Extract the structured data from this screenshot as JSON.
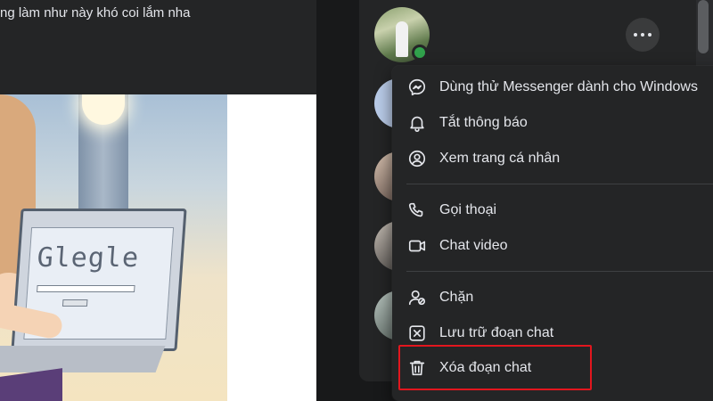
{
  "post": {
    "text": "ng làm như này khó coi lắm nha",
    "image_logo_text": "Glegle"
  },
  "chat": {
    "more_button": "more-options"
  },
  "menu": {
    "items": [
      {
        "label": "Dùng thử Messenger dành cho Windows",
        "icon": "messenger-icon"
      },
      {
        "label": "Tắt thông báo",
        "icon": "bell-icon"
      },
      {
        "label": "Xem trang cá nhân",
        "icon": "profile-icon"
      },
      {
        "label": "Gọi thoại",
        "icon": "phone-icon"
      },
      {
        "label": "Chat video",
        "icon": "video-icon"
      },
      {
        "label": "Chặn",
        "icon": "block-user-icon"
      },
      {
        "label": "Lưu trữ đoạn chat",
        "icon": "archive-icon"
      },
      {
        "label": "Xóa đoạn chat",
        "icon": "trash-icon"
      }
    ]
  },
  "colors": {
    "background": "#18191a",
    "surface": "#242526",
    "text": "#e4e6eb",
    "online": "#31a24c",
    "highlight_box": "#e2161e"
  }
}
